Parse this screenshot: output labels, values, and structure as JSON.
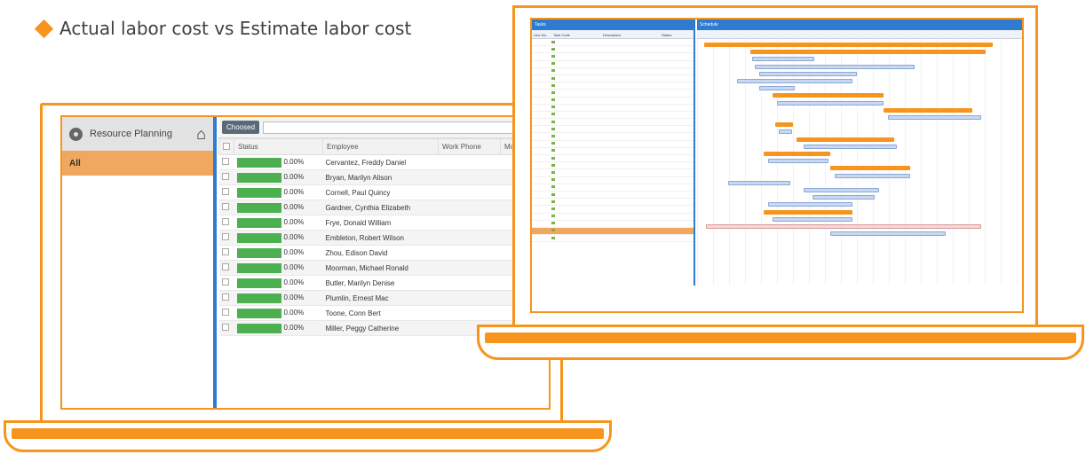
{
  "heading": "Actual labor cost vs Estimate labor cost",
  "resource_planning": {
    "title": "Resource Planning",
    "filter_all": "All",
    "choosed_button": "Choosed",
    "columns": [
      "Status",
      "Employee",
      "Work Phone",
      "Mobile"
    ],
    "rows": [
      {
        "pct": "0.00%",
        "employee": "Cervantez, Freddy Daniel"
      },
      {
        "pct": "0.00%",
        "employee": "Bryan, Marilyn Alison"
      },
      {
        "pct": "0.00%",
        "employee": "Cornell, Paul Quincy"
      },
      {
        "pct": "0.00%",
        "employee": "Gardner, Cynthia Elizabeth"
      },
      {
        "pct": "0.00%",
        "employee": "Frye, Donald William"
      },
      {
        "pct": "0.00%",
        "employee": "Embleton, Robert Wilson"
      },
      {
        "pct": "0.00%",
        "employee": "Zhou, Edison David"
      },
      {
        "pct": "0.00%",
        "employee": "Moorman, Michael Ronald"
      },
      {
        "pct": "0.00%",
        "employee": "Butler, Marilyn Denise"
      },
      {
        "pct": "0.00%",
        "employee": "Plumlin, Ernest Mac"
      },
      {
        "pct": "0.00%",
        "employee": "Toone, Conn Bert"
      },
      {
        "pct": "0.00%",
        "employee": "Miller, Peggy Catherine"
      }
    ]
  },
  "gantt": {
    "tasks_header": "Tasks",
    "schedule_header": "Schedule",
    "columns": [
      "Line No.",
      "Task Code",
      "Description",
      "Status"
    ]
  },
  "colors": {
    "accent": "#f7941d",
    "status_green": "#4caf50",
    "blue": "#2e7bd0"
  }
}
